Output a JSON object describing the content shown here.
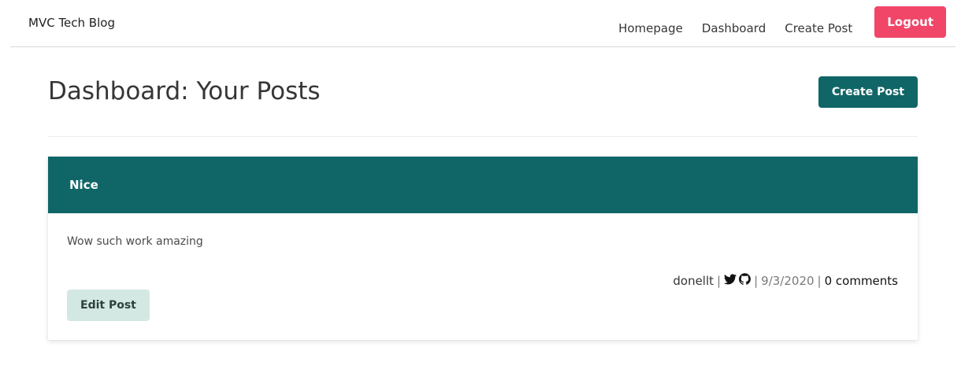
{
  "nav": {
    "brand": "MVC Tech Blog",
    "links": [
      {
        "label": "Homepage"
      },
      {
        "label": "Dashboard"
      },
      {
        "label": "Create Post"
      }
    ],
    "logout_label": "Logout"
  },
  "dashboard": {
    "title": "Dashboard: Your Posts",
    "create_post_label": "Create Post"
  },
  "posts": [
    {
      "title": "Nice",
      "body": "Wow such work amazing",
      "author": "donellt",
      "date": "9/3/2020",
      "comments": "0 comments",
      "edit_label": "Edit Post",
      "icons": [
        "twitter-icon",
        "github-icon"
      ]
    }
  ],
  "colors": {
    "accent": "#106667",
    "logout": "#f14668",
    "edit_button": "#d3e8e3"
  }
}
